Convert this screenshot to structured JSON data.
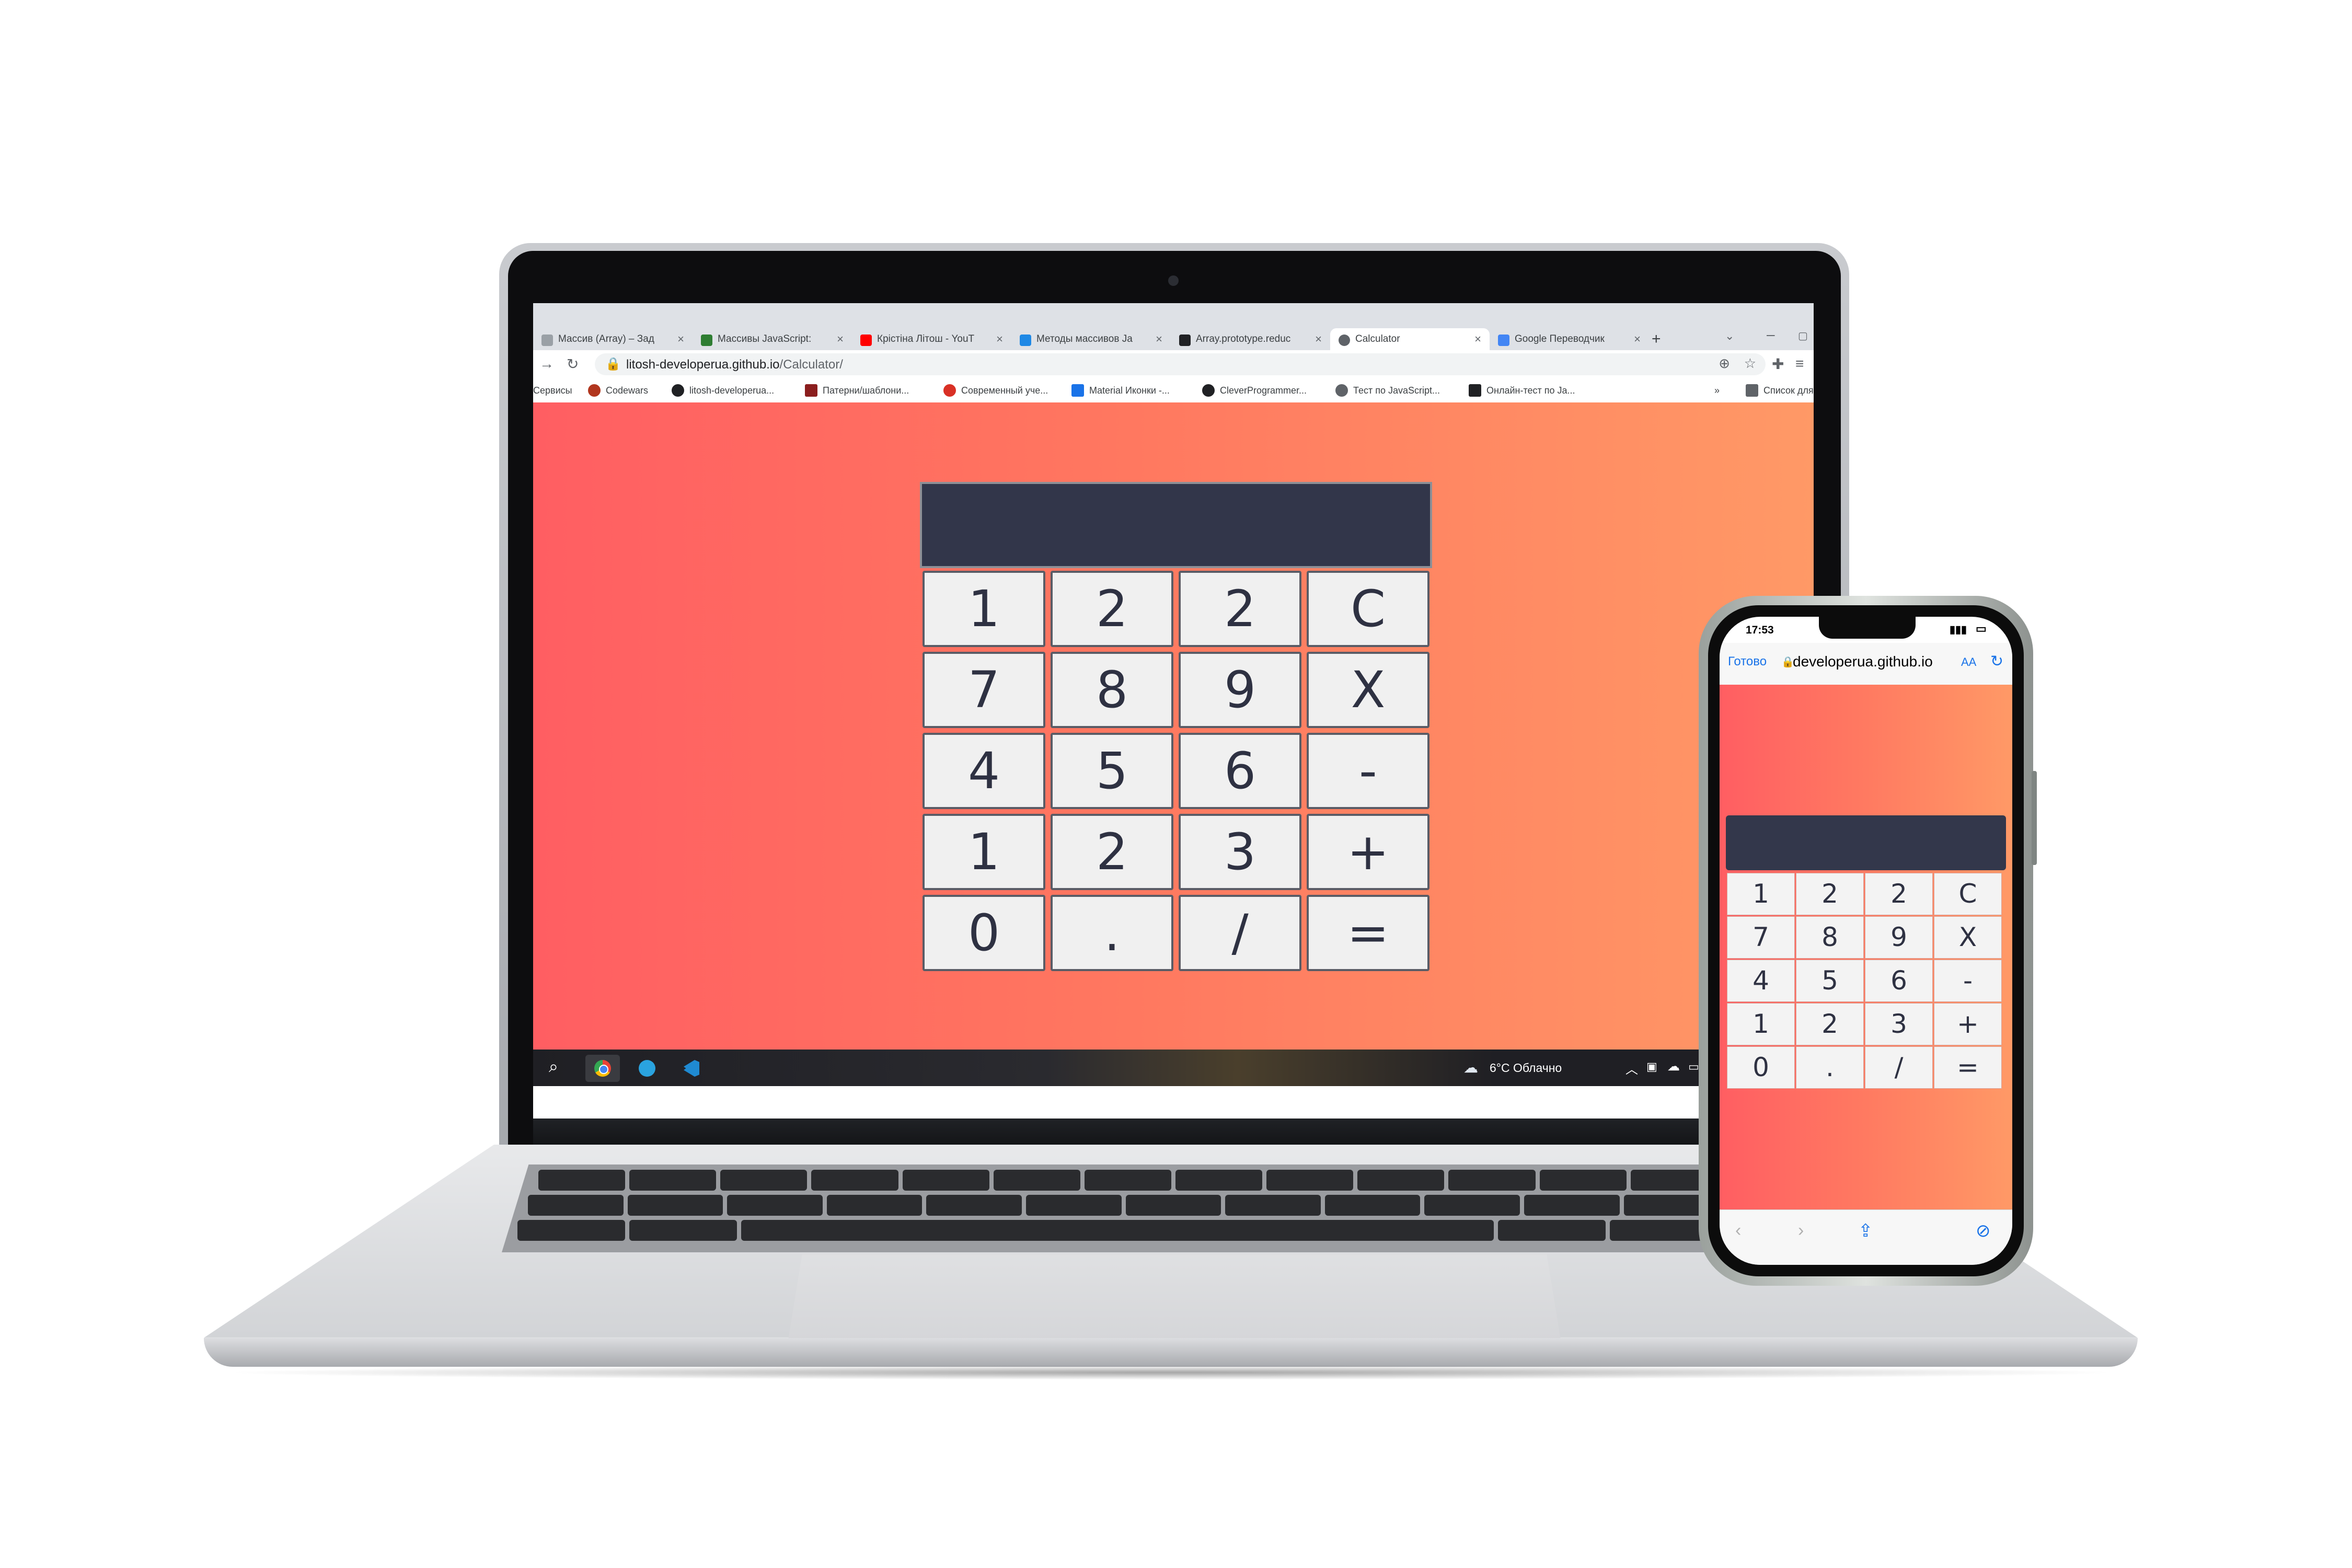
{
  "browser": {
    "tabs": [
      {
        "label": "Массив (Array) – Зад",
        "favicon_color": "#9aa0a6"
      },
      {
        "label": "Массивы JavaScript:",
        "favicon_color": "#2e7d32"
      },
      {
        "label": "Крістіна Літош - YouT",
        "favicon_color": "#ff0000"
      },
      {
        "label": "Методы массивов Ja",
        "favicon_color": "#1e88e5"
      },
      {
        "label": "Array.prototype.reduc",
        "favicon_color": "#202124"
      },
      {
        "label": "Calculator",
        "favicon_color": "#5f6368"
      },
      {
        "label": "Google Переводчик",
        "favicon_color": "#4285f4"
      }
    ],
    "active_tab": 5,
    "address": {
      "host": "litosh-developerua.github.io",
      "path": "/Calculator/"
    },
    "bookmarks": [
      {
        "label": "Сервисы",
        "icon_color": "#9aa0a6"
      },
      {
        "label": "Codewars",
        "icon_color": "#b1361e"
      },
      {
        "label": "litosh-developerua...",
        "icon_color": "#202124"
      },
      {
        "label": "Патерни/шаблони...",
        "icon_color": "#8b1e1e"
      },
      {
        "label": "Современный уче...",
        "icon_color": "#d93025"
      },
      {
        "label": "Material Иконки -...",
        "icon_color": "#1a73e8"
      },
      {
        "label": "CleverProgrammer...",
        "icon_color": "#202124"
      },
      {
        "label": "Тест по JavaScript...",
        "icon_color": "#5f6368"
      },
      {
        "label": "Онлайн-тест по Ja...",
        "icon_color": "#202124"
      },
      {
        "label": "Список для чтения",
        "icon_color": "#5f6368"
      }
    ],
    "more_bookmarks": "»"
  },
  "calculator": {
    "display_value": "",
    "keys": [
      "1",
      "2",
      "2",
      "C",
      "7",
      "8",
      "9",
      "X",
      "4",
      "5",
      "6",
      "-",
      "1",
      "2",
      "3",
      "+",
      "0",
      ".",
      "/",
      "="
    ]
  },
  "taskbar": {
    "weather": "6°C  Облачно",
    "apps": [
      "search-icon",
      "chrome-icon",
      "telegram-icon",
      "vscode-icon"
    ]
  },
  "phone": {
    "time": "17:53",
    "done_label": "Готово",
    "url": "developerua.github.io",
    "text_size_label": "AA"
  },
  "colors": {
    "gradient_start": "#ff5e62",
    "gradient_end": "#ff9966",
    "display": "#32364a",
    "key_face": "#f0f0f0",
    "key_text": "#2e3142"
  }
}
